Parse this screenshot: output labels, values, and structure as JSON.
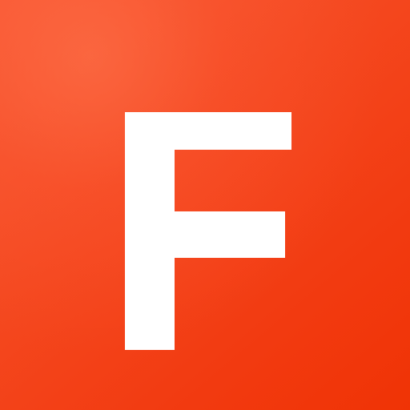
{
  "app_icon": {
    "icon": "letter-f-logo-icon",
    "glyph": "F",
    "colors": {
      "background_light": "#f75a34",
      "background_dark": "#f03305",
      "glyph": "#ffffff"
    }
  }
}
